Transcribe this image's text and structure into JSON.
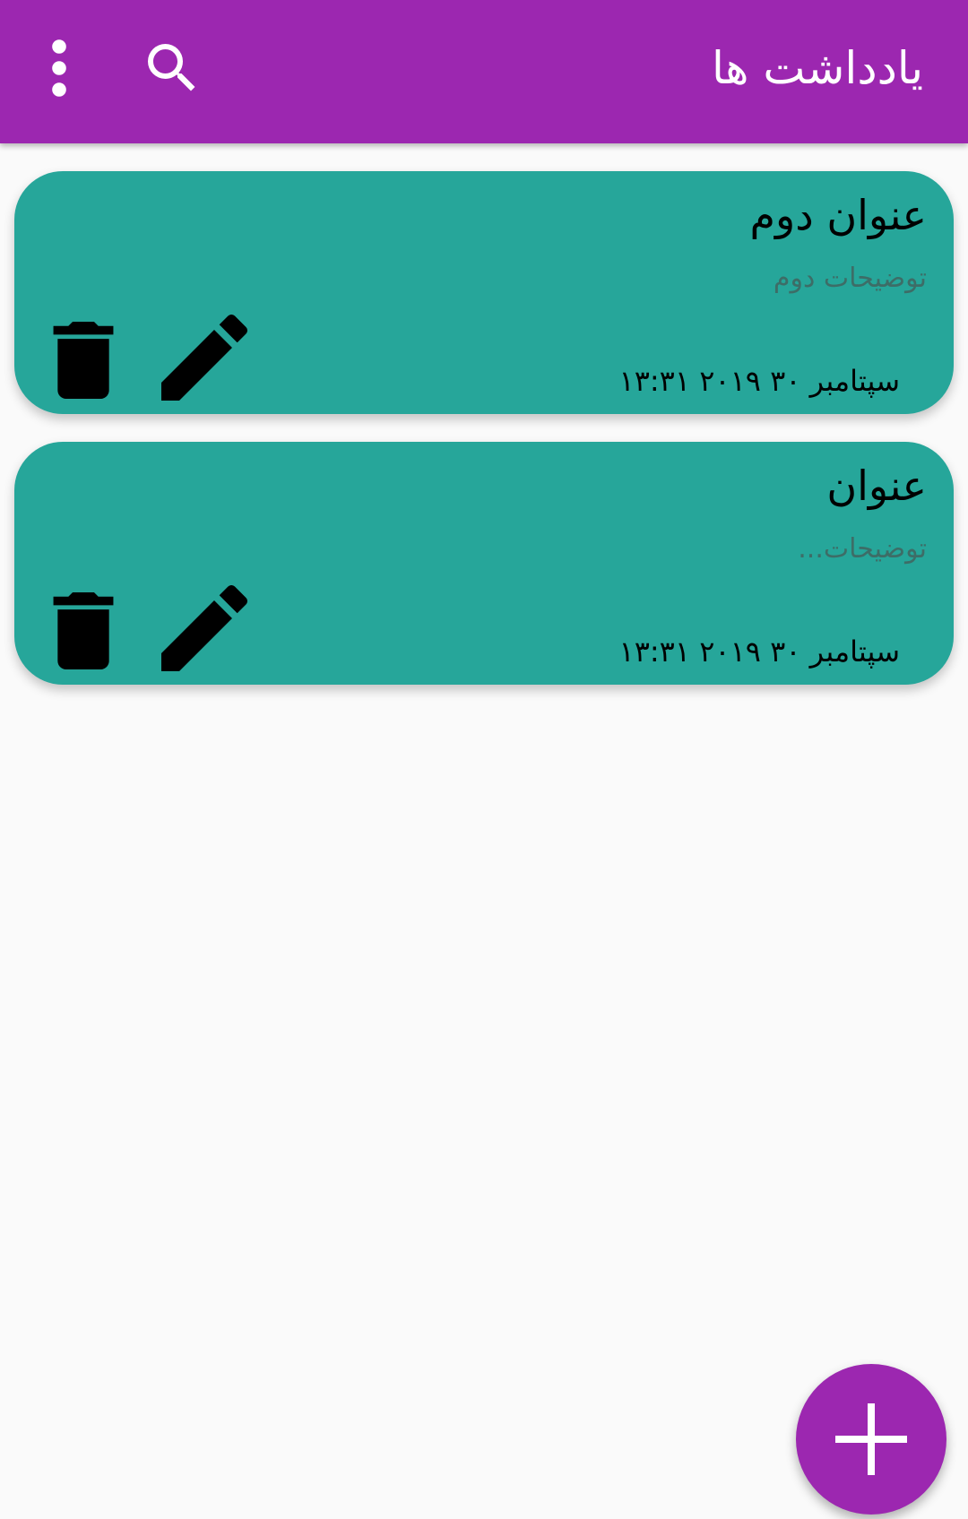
{
  "app_bar": {
    "title": "یادداشت ها",
    "background_color": "#9c27b0",
    "actions": [
      {
        "icon": "search-icon"
      },
      {
        "icon": "more-vert-icon"
      }
    ]
  },
  "notes": [
    {
      "title": "عنوان دوم",
      "description": "توضیحات دوم",
      "date": "سپتامبر ۳۰ ۲۰۱۹ ۱۳:۳۱",
      "card_color": "#26a69a",
      "actions": [
        {
          "icon": "edit-icon"
        },
        {
          "icon": "delete-icon"
        }
      ]
    },
    {
      "title": "عنوان",
      "description": "توضیحات...",
      "date": "سپتامبر ۳۰ ۲۰۱۹ ۱۳:۳۱",
      "card_color": "#26a69a",
      "actions": [
        {
          "icon": "edit-icon"
        },
        {
          "icon": "delete-icon"
        }
      ]
    }
  ],
  "fab": {
    "icon": "add-icon",
    "color": "#9c27b0"
  },
  "colors": {
    "background": "#fafafa",
    "primary": "#9c27b0",
    "card": "#26a69a"
  }
}
